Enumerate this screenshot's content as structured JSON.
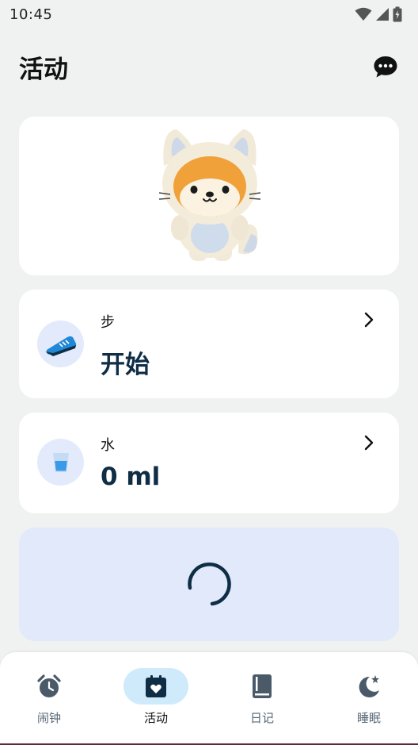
{
  "status_bar": {
    "time": "10:45",
    "icons": [
      "wifi-icon",
      "cellular-signal-icon",
      "battery-charging-icon"
    ]
  },
  "header": {
    "title": "活动",
    "action_icon": "chat-bubble-icon"
  },
  "mascot": {
    "icon": "cat-costume-shiba-mascot"
  },
  "steps_card": {
    "label": "步",
    "value": "开始",
    "icon": "shoe-icon"
  },
  "water_card": {
    "label": "水",
    "value": "0 ml",
    "icon": "water-glass-icon"
  },
  "loading_card": {
    "icon": "loading-spinner-icon"
  },
  "bottom_nav": {
    "items": [
      {
        "label": "闹钟",
        "icon": "alarm-clock-icon",
        "active": false
      },
      {
        "label": "活动",
        "icon": "calendar-heart-icon",
        "active": true
      },
      {
        "label": "日记",
        "icon": "diary-book-icon",
        "active": false
      },
      {
        "label": "睡眠",
        "icon": "moon-star-icon",
        "active": false
      }
    ]
  },
  "colors": {
    "background": "#f0f2f2",
    "card": "#ffffff",
    "accent_dark": "#0f2e46",
    "icon_circle": "#e3eafb",
    "loading_bg": "#e1e9fb",
    "nav_active_pill": "#cfeafb"
  }
}
